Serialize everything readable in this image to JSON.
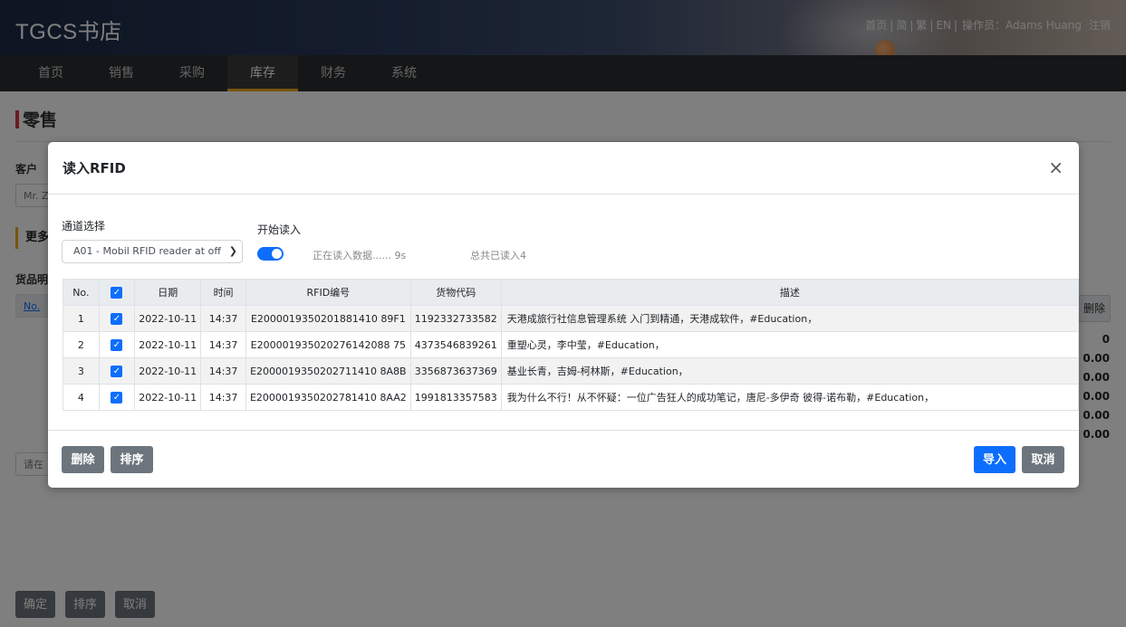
{
  "app": {
    "brand": "TGCS书店"
  },
  "top_links": {
    "home": "首页",
    "simplified": "简",
    "traditional": "繁",
    "english": "EN",
    "sep": "|",
    "operator": "操作员：Adams Huang",
    "logout": "注销"
  },
  "nav": {
    "items": [
      {
        "label": "首页"
      },
      {
        "label": "销售"
      },
      {
        "label": "采购"
      },
      {
        "label": "库存",
        "active": true
      },
      {
        "label": "财务"
      },
      {
        "label": "系统"
      }
    ]
  },
  "page": {
    "title": "零售",
    "customer_label": "客户",
    "customer_value": "Mr. Z",
    "section_title": "更多",
    "goods_label": "货品明",
    "col_no": "No.",
    "delete_label": "删除",
    "totals": [
      "0",
      "0.00",
      "0.00",
      "0.00",
      "0.00",
      "0.00"
    ],
    "input_placeholder": "请在",
    "buttons": {
      "confirm": "确定",
      "sort": "排序",
      "cancel": "取消"
    }
  },
  "modal": {
    "title": "读入RFID",
    "close": "×",
    "channel_label": "通道选择",
    "channel_value": "A01 - Mobil RFID reader at off",
    "start_label": "开始读入",
    "reading_status": "正在读入数据...... 9s",
    "total_read": "总共已读入4",
    "table": {
      "headers": [
        "No.",
        "日期",
        "时间",
        "RFID编号",
        "货物代码",
        "描述"
      ],
      "rows": [
        {
          "no": "1",
          "date": "2022-10-11",
          "time": "14:37",
          "rfid": "E2000019350201881410 89F1",
          "code": "1192332733582",
          "desc": "天港成旅行社信息管理系统 入门到精通，天港成软件，#Education，",
          "checked": true
        },
        {
          "no": "2",
          "date": "2022-10-11",
          "time": "14:37",
          "rfid": "E200001935020276142088 75",
          "code": "4373546839261",
          "desc": "重塑心灵，李中莹，#Education，",
          "checked": true
        },
        {
          "no": "3",
          "date": "2022-10-11",
          "time": "14:37",
          "rfid": "E2000019350202711410 8A8B",
          "code": "3356873637369",
          "desc": "基业长青，吉姆-柯林斯，#Education，",
          "checked": true
        },
        {
          "no": "4",
          "date": "2022-10-11",
          "time": "14:37",
          "rfid": "E2000019350202781410 8AA2",
          "code": "1991813357583",
          "desc": "我为什么不行！从不怀疑：一位广告狂人的成功笔记，唐尼-多伊奇 彼得-诺布勒，#Education，",
          "checked": true
        }
      ]
    },
    "buttons": {
      "delete": "删除",
      "sort": "排序",
      "import": "导入",
      "cancel": "取消"
    }
  }
}
